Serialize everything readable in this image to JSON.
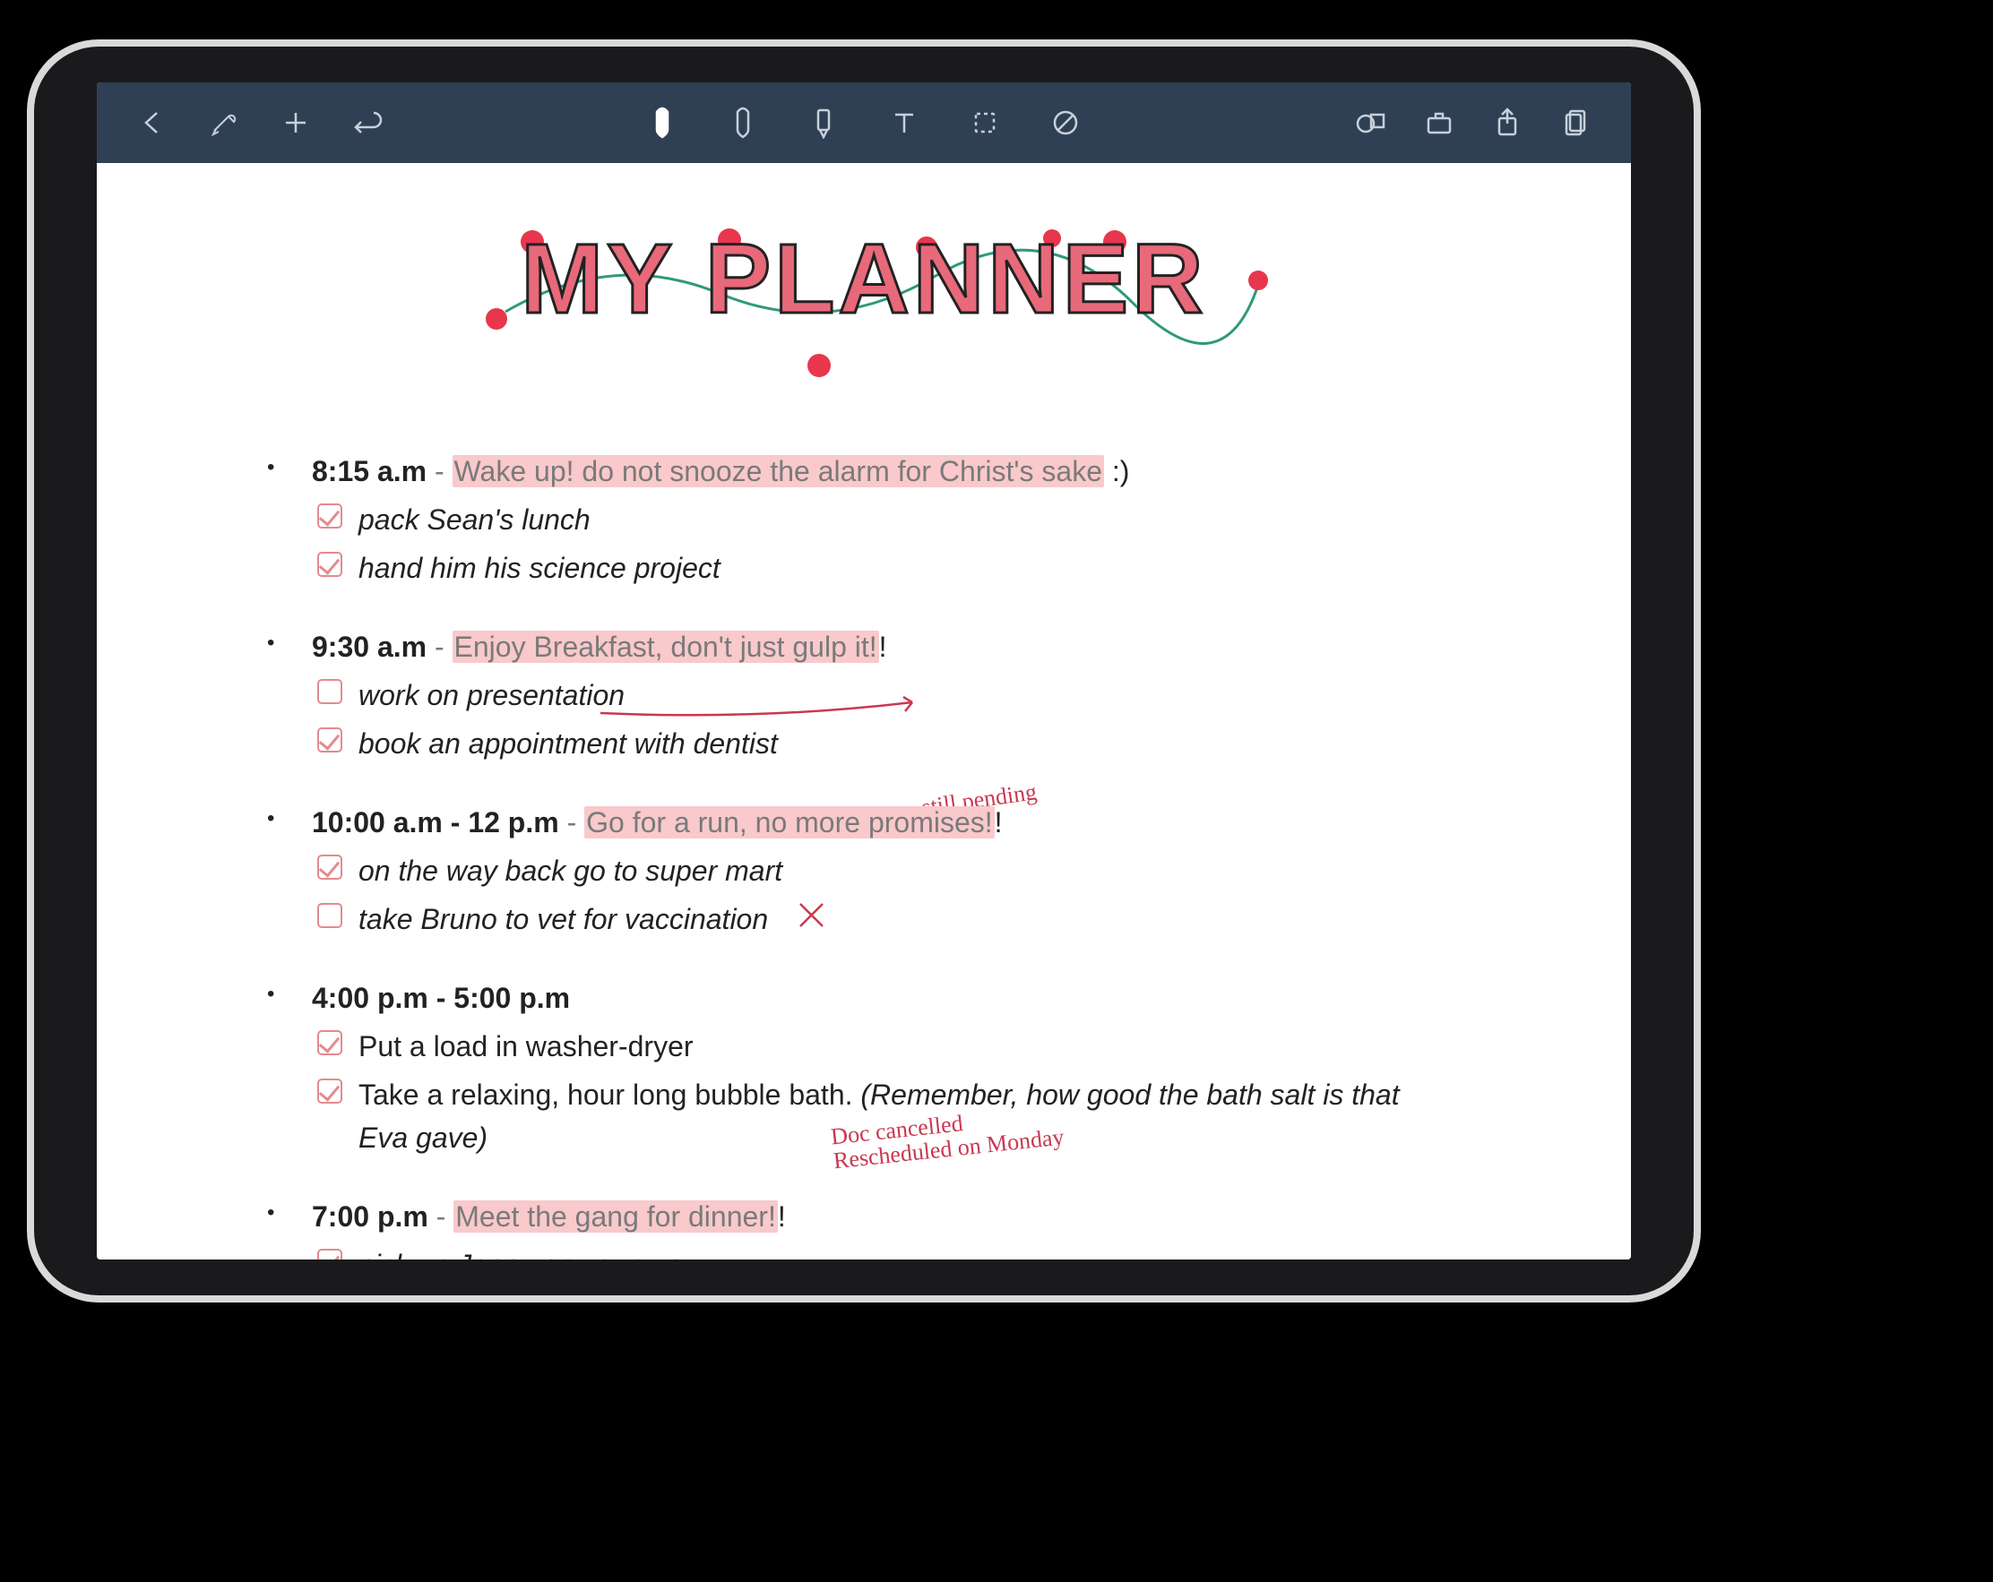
{
  "title": "MY PLANNER",
  "toolbar": {
    "back": "back",
    "settings": "settings",
    "add": "add",
    "undo": "undo",
    "pen": "pen",
    "pencil": "pencil",
    "highlighter": "highlighter",
    "text": "text",
    "select": "select",
    "eraser": "eraser",
    "shapes": "shapes",
    "media": "media",
    "share": "share",
    "pages": "pages"
  },
  "entries": [
    {
      "time": "8:15 a.m",
      "note_hl": "Wake up! do not snooze the alarm for Christ's sake",
      "note_suffix": " :)",
      "subs": [
        {
          "checked": true,
          "text": "pack Sean's lunch"
        },
        {
          "checked": true,
          "text": "hand him his science project"
        }
      ]
    },
    {
      "time": "9:30 a.m",
      "note_hl": "Enjoy Breakfast, don't just gulp it!",
      "note_suffix": "!",
      "subs": [
        {
          "checked": false,
          "text": "work on presentation"
        },
        {
          "checked": true,
          "text": "book an appointment with dentist"
        }
      ],
      "annot_pending": "still pending"
    },
    {
      "time": "10:00 a.m - 12 p.m",
      "note_hl": "Go for a run, no more promises!",
      "note_suffix": "!",
      "subs": [
        {
          "checked": true,
          "text": "on the way back go to super mart"
        },
        {
          "checked": false,
          "text": "take Bruno to vet for vaccination"
        }
      ],
      "annot_doc1": "Doc cancelled",
      "annot_doc2": "Rescheduled on Monday"
    },
    {
      "time": "4:00 p.m - 5:00 p.m",
      "note_hl": "",
      "note_suffix": "",
      "subs": [
        {
          "checked": true,
          "text": "Put a load in washer-dryer",
          "plain": true
        },
        {
          "checked": true,
          "text": "Take a relaxing, hour long bubble bath. ",
          "paren": "(Remember, how good the bath salt is that Eva gave)",
          "plain": true
        }
      ]
    },
    {
      "time": "7:00 p.m",
      "note_hl": "Meet the gang for dinner!",
      "note_suffix": "!",
      "subs": [
        {
          "checked": true,
          "text": " pick up Jenny on your way"
        }
      ]
    }
  ]
}
